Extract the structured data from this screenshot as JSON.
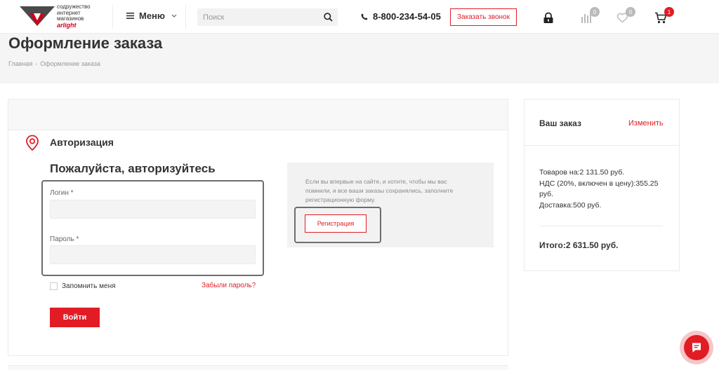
{
  "header": {
    "logo_lines": [
      "содружество",
      "интернет",
      "магазинов",
      "arlight"
    ],
    "menu_label": "Меню",
    "search_placeholder": "Поиск",
    "phone": "8-800-234-54-05",
    "callback_label": "Заказать звонок",
    "compare_count": "0",
    "wishlist_count": "0",
    "cart_count": "1",
    "accent_color": "#e11c24"
  },
  "page": {
    "title": "Оформление заказа",
    "breadcrumbs": [
      "Главная",
      "Оформление заказа"
    ]
  },
  "auth": {
    "section_title": "Авторизация",
    "heading": "Пожалуйста, авторизуйтесь",
    "login_label": "Логин *",
    "password_label": "Пароль *",
    "remember_label": "Запомнить меня",
    "forgot_label": "Забыли пароль?",
    "submit_label": "Войти",
    "register_text": "Если вы впервые на сайте, и хотите, чтобы мы вас помнили, и все ваши заказы сохранялись, заполните регистрационную форму.",
    "register_label": "Регистрация"
  },
  "order": {
    "title": "Ваш заказ",
    "edit_label": "Изменить",
    "goods": "Товаров на:2 131.50 руб.",
    "vat": "НДС (20%, включен в цену):355.25 руб.",
    "delivery": "Доставка:500 руб.",
    "total": "Итого:2 631.50 руб."
  }
}
